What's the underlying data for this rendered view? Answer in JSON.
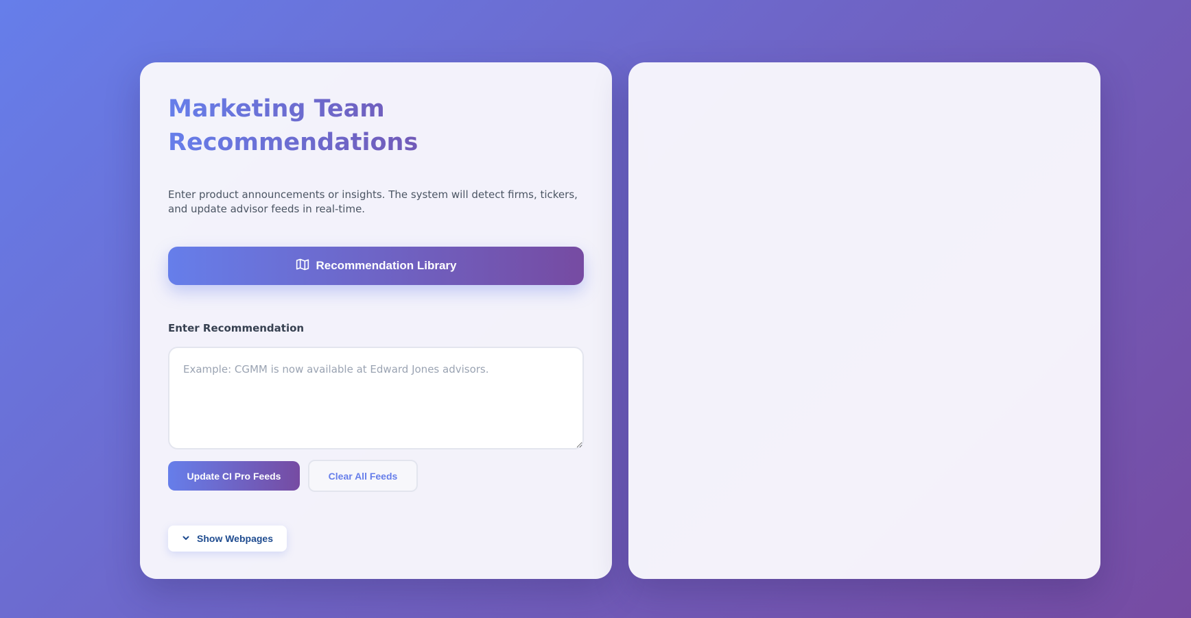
{
  "left_panel": {
    "title": "Marketing Team Recommendations",
    "description": "Enter product announcements or insights. The system will detect firms, tickers, and update advisor feeds in real-time.",
    "library_button": {
      "label": "Recommendation Library",
      "icon": "map-icon"
    },
    "recommendation_field": {
      "label": "Enter Recommendation",
      "value": "",
      "placeholder": "Example: CGMM is now available at Edward Jones advisors."
    },
    "update_button": {
      "label": "Update CI Pro Feeds"
    },
    "clear_button": {
      "label": "Clear All Feeds"
    },
    "show_webpages_button": {
      "label": "Show Webpages",
      "icon": "chevron-down-icon"
    }
  },
  "colors": {
    "accent_start": "#667eea",
    "accent_end": "#764ba2",
    "show_webpages_text": "#1e4b8f"
  }
}
